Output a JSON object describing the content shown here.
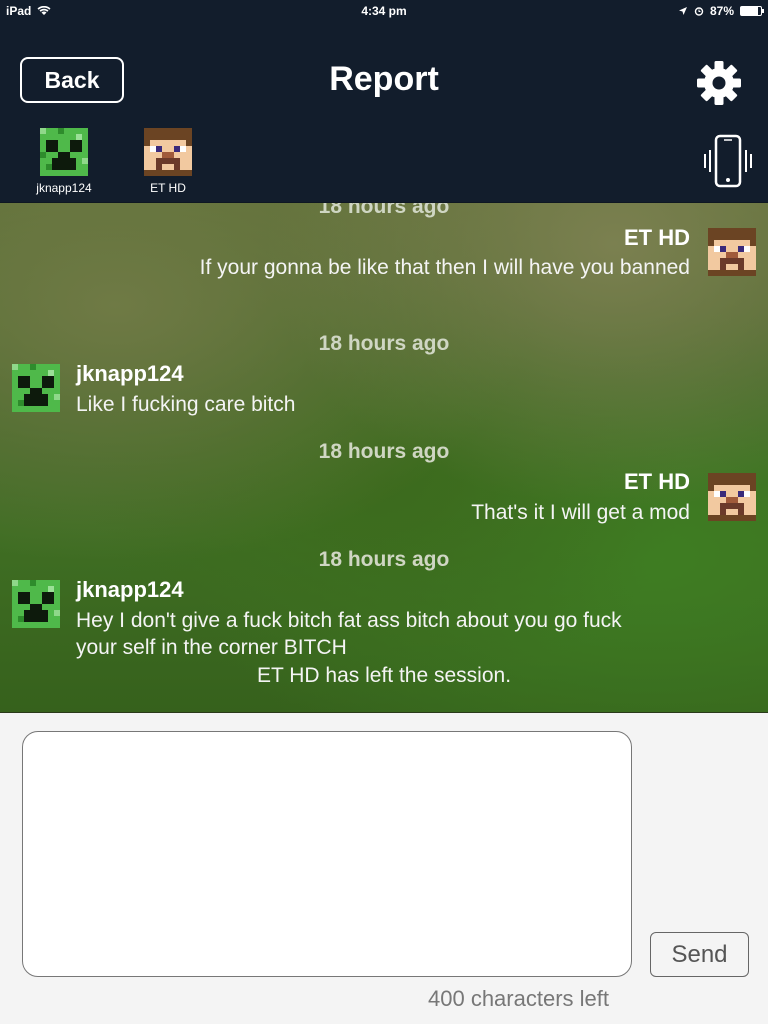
{
  "status_bar": {
    "device": "iPad",
    "time": "4:34 pm",
    "battery_percent": "87%"
  },
  "header": {
    "back_label": "Back",
    "title": "Report",
    "settings_icon": "gear-icon",
    "vibrate_icon": "phone-vibrate-icon"
  },
  "participants": [
    {
      "name": "jknapp124",
      "avatar": "creeper-avatar"
    },
    {
      "name": "ET HD",
      "avatar": "steve-avatar"
    }
  ],
  "messages": [
    {
      "time": "18 hours ago",
      "sender": "ET HD",
      "text": "If your gonna be like that then I will have you banned"
    },
    {
      "time": "18 hours ago",
      "sender": "jknapp124",
      "text": "Like I fucking care bitch"
    },
    {
      "time": "18 hours ago",
      "sender": "ET HD",
      "text": "That's it I will get a mod"
    },
    {
      "time": "18 hours ago",
      "sender": "jknapp124",
      "text_line1": "Hey I don't give a fuck bitch fat ass bitch about you go fuck",
      "text_line2": "your self in the corner BITCH"
    }
  ],
  "system_message": "ET HD has left the session.",
  "composer": {
    "value": "",
    "send_label": "Send",
    "char_count": "400 characters left"
  }
}
